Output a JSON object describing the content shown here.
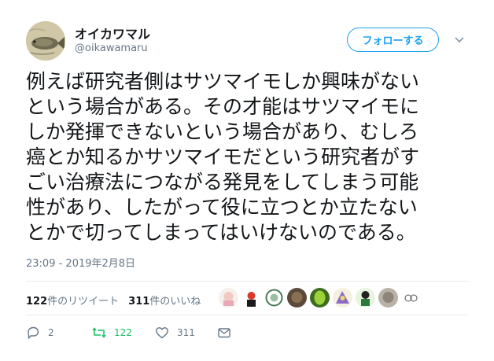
{
  "user": {
    "display_name": "オイカワマル",
    "handle": "@oikawamaru",
    "follow_label": "フォローする"
  },
  "tweet": {
    "lines": [
      "例えば研究者側はサツマイモしか興味がない",
      "という場合がある。その才能はサツマイモに",
      "しか発揮できないという場合があり、むしろ",
      "癌とか知るかサツマイモだという研究者がす",
      "ごい治療法につながる発見をしてしまう可能",
      "性があり、したがって役に立つとか立たない",
      "とかで切ってしまってはいけないのである。"
    ],
    "timestamp": "23:09 - 2019年2月8日"
  },
  "stats": {
    "retweets_count": "122",
    "retweets_label": "件のリツイート",
    "likes_count": "311",
    "likes_label": "件のいいね"
  },
  "actions": {
    "reply_count": "2",
    "retweet_count": "122",
    "like_count": "311"
  },
  "colors": {
    "accent": "#1da1f2",
    "retweet_green": "#17bf63",
    "muted": "#657786"
  },
  "icons": [
    "reply-icon",
    "retweet-icon",
    "heart-icon",
    "mail-icon",
    "chevron-down-icon"
  ]
}
